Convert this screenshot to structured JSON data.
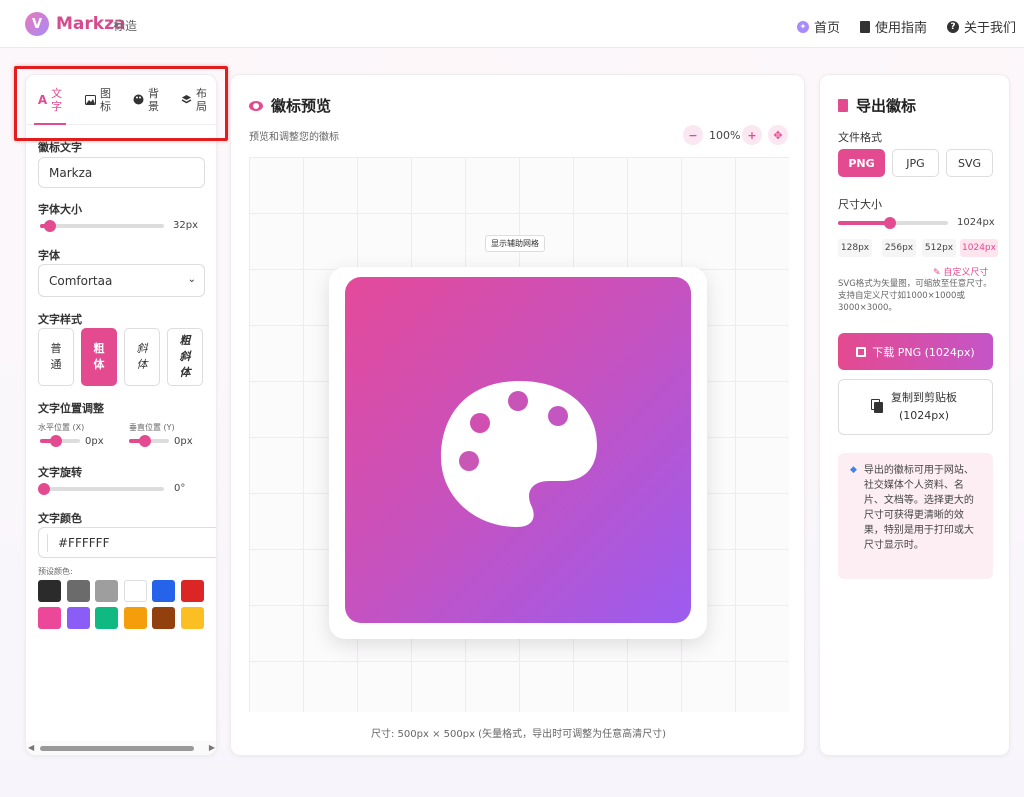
{
  "header": {
    "brand": "Markza",
    "brand_sub": "标造",
    "nav": {
      "home": "首页",
      "guide": "使用指南",
      "about": "关于我们"
    }
  },
  "left": {
    "tabs": [
      {
        "icon": "A",
        "label": "文字"
      },
      {
        "icon": "",
        "label": "图标"
      },
      {
        "icon": "",
        "label": "背景"
      },
      {
        "icon": "",
        "label": "布局"
      }
    ],
    "text_label": "徽标文字",
    "text_value": "Markza",
    "font_size_label": "字体大小",
    "font_size_value": "32px",
    "font_size_fraction": 0.08,
    "font_label": "字体",
    "font_value": "Comfortaa",
    "style_label": "文字样式",
    "styles": [
      {
        "label": "普通"
      },
      {
        "label": "粗体"
      },
      {
        "label": "斜体"
      },
      {
        "label": "粗斜体"
      }
    ],
    "position_label": "文字位置调整",
    "pos_x_label": "水平位置 (X)",
    "pos_x_value": "0px",
    "pos_y_label": "垂直位置 (Y)",
    "pos_y_value": "0px",
    "rotation_label": "文字旋转",
    "rotation_value": "0°",
    "color_label": "文字颜色",
    "color_value": "#FFFFFF",
    "preset_label": "预设颜色:",
    "preset_colors": [
      "#2b2b2b",
      "#6b6b6b",
      "#9e9e9e",
      "#ffffff",
      "#2563eb",
      "#dc2626",
      "#ec4899",
      "#8b5cf6",
      "#10b981",
      "#f59e0b",
      "#92400e",
      "#fbbf24"
    ]
  },
  "center": {
    "title": "徽标预览",
    "subtitle": "预览和调整您的徽标",
    "zoom": "100%",
    "grid_toggle": "显示辅助网格",
    "footer": "尺寸: 500px × 500px (矢量格式，导出时可调整为任意高清尺寸)",
    "gradient_from": "#e44a9a",
    "gradient_to": "#9b5cf0"
  },
  "right": {
    "title": "导出徽标",
    "format_label": "文件格式",
    "formats": [
      "PNG",
      "JPG",
      "SVG"
    ],
    "size_label": "尺寸大小",
    "size_value": "1024px",
    "presets": [
      "128px",
      "256px",
      "512px",
      "1024px"
    ],
    "custom_size": "自定义尺寸",
    "note": "SVG格式为矢量图，可缩放至任意尺寸。支持自定义尺寸如1000×1000或3000×3000。",
    "download": "下载 PNG (1024px)",
    "copy_line1": "复制到剪贴板",
    "copy_line2": "(1024px)",
    "info": "导出的徽标可用于网站、社交媒体个人资料、名片、文档等。选择更大的尺寸可获得更清晰的效果，特别是用于打印或大尺寸显示时。"
  },
  "colors": {
    "accent": "#e44a8f"
  }
}
